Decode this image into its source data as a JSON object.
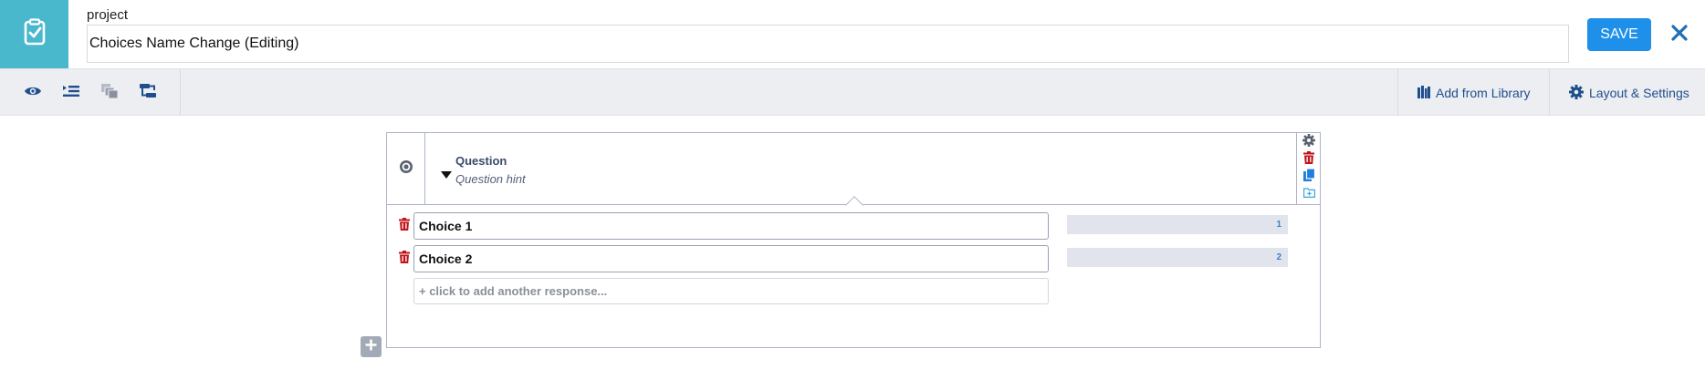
{
  "header": {
    "project_label": "project",
    "title_value": "Choices Name Change (Editing)",
    "save_label": "SAVE",
    "close_icon": "close-icon",
    "logo_icon": "clipboard-check-icon",
    "brand_color": "#4ab8cc",
    "save_color": "#1e90ea"
  },
  "toolbar": {
    "left_icons": [
      "eye-icon",
      "indent-list-icon",
      "layers-icon",
      "logic-branch-icon"
    ],
    "add_from_library_label": "Add from Library",
    "layout_settings_label": "Layout & Settings"
  },
  "question": {
    "type_icon": "radio-icon",
    "title": "Question",
    "hint": "Question hint",
    "side_icons": [
      "gear-icon",
      "trash-icon",
      "duplicate-icon",
      "folder-add-icon"
    ],
    "choices": [
      {
        "label": "Choice 1",
        "value": "1"
      },
      {
        "label": "Choice 2",
        "value": "2"
      }
    ],
    "add_response_placeholder": "+ click to add another response..."
  },
  "colors": {
    "delete": "#c0141b",
    "link": "#1f4e8c",
    "accent": "#1e90ea"
  }
}
